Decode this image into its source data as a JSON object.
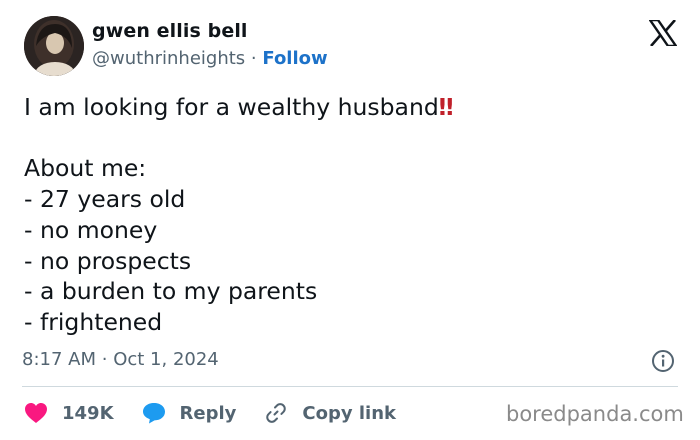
{
  "author": {
    "name": "gwen ellis bell",
    "handle": "@wuthrinheights",
    "separator": "·",
    "follow_label": "Follow"
  },
  "tweet": {
    "headline": "I am looking for a wealthy husband",
    "emoji": "‼",
    "body": "About me:\n- 27 years old\n- no money\n- no prospects\n- a burden to my parents\n- frightened",
    "time": "8:17 AM",
    "date": "Oct 1, 2024"
  },
  "actions": {
    "likes": "149K",
    "reply_label": "Reply",
    "copy_link_label": "Copy link"
  },
  "watermark": "boredpanda.com",
  "colors": {
    "follow": "#1d72c9",
    "like_heart": "#f91880",
    "reply_bubble": "#1d9bf0",
    "muted": "#536471",
    "emoji": "#c0202a"
  },
  "icons": [
    "x-logo-icon",
    "info-icon",
    "heart-icon",
    "reply-bubble-icon",
    "link-icon"
  ]
}
